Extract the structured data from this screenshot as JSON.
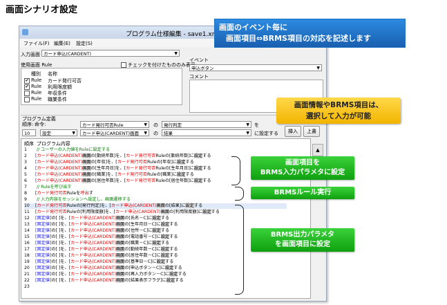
{
  "page_title": "画面シナリオ設定",
  "callout_top": {
    "line1": "画面のイベント毎に",
    "line2": "画面項目⇔BRMS項目の対応を記述します"
  },
  "window": {
    "title": "プログラム仕様編集 - save1.xml",
    "menu": [
      "ファイル(F)",
      "編集(E)",
      "設定(S)"
    ]
  },
  "screen_panel": {
    "label": "入力画面",
    "select_value": "カード申込(CARDENT)",
    "rule_used_label": "使用画面 Rule",
    "checked_only_label": "チェックを付けたもののみ表示",
    "header": {
      "kind": "種別",
      "name": "名称"
    },
    "rules": [
      {
        "checked": true,
        "kind": "Rule",
        "name": "カード発行可否"
      },
      {
        "checked": true,
        "kind": "Rule",
        "name": "利用限度額"
      },
      {
        "checked": false,
        "kind": "Rule",
        "name": "年収条件"
      },
      {
        "checked": false,
        "kind": "Rule",
        "name": "職業条件"
      }
    ]
  },
  "event_panel": {
    "label": "イベント",
    "select_value": "申込ボタン",
    "comment_label": "コメント"
  },
  "callout_select": {
    "line1": "画面情報やBRMS項目は、",
    "line2": "選択して入力が可能"
  },
  "program_def": {
    "section_label": "プログラム定義",
    "order_label": "順序:",
    "command_label": "命令:",
    "row1": {
      "field1": "カード発行可否Rule",
      "no": "の",
      "field2": "発行判定",
      "suffix": "を"
    },
    "row2": {
      "order": "10",
      "command": "設定",
      "field1": "カード申込(CARDENT)画面",
      "no": "の",
      "field2": "結果",
      "suffix": "に設定する"
    },
    "insert_button": "挿入",
    "overwrite_button": "上書"
  },
  "code": {
    "header_order": "順序",
    "header_content": "プログラム内容",
    "lines": [
      {
        "n": "1",
        "type": "comment",
        "text": "// ユーザーの入力値をRuleに設定する"
      },
      {
        "n": "2",
        "type": "in",
        "field": "勤続年数",
        "target": "勤続年数"
      },
      {
        "n": "3",
        "type": "in",
        "field": "年収",
        "target": "年収"
      },
      {
        "n": "4",
        "type": "in",
        "field": "生年月日",
        "target": "生年月日"
      },
      {
        "n": "5",
        "type": "in",
        "field": "職業",
        "target": "職業"
      },
      {
        "n": "6",
        "type": "in",
        "field": "居住年数",
        "target": "居住年数"
      },
      {
        "n": "7",
        "type": "comment",
        "text": "// Ruleを呼び出す"
      },
      {
        "n": "8",
        "type": "call"
      },
      {
        "n": "9",
        "type": "comment",
        "text": "// 入力内容をセッションへ設定し、画面遷移する"
      },
      {
        "n": "10",
        "type": "out",
        "rule_field": "発行判定",
        "screen_field": "結果"
      },
      {
        "n": "11",
        "type": "out",
        "rule_field": "利用限度額",
        "screen_field": "利用限度額"
      },
      {
        "n": "12",
        "type": "sess",
        "field": "氏名－C"
      },
      {
        "n": "13",
        "type": "sess",
        "field": "生年月日－C"
      },
      {
        "n": "14",
        "type": "sess",
        "field": "住所－C"
      },
      {
        "n": "15",
        "type": "sess",
        "field": "電話番号－C"
      },
      {
        "n": "16",
        "type": "sess",
        "field": "職業－C"
      },
      {
        "n": "17",
        "type": "sess",
        "field": "勤続年数－C"
      },
      {
        "n": "18",
        "type": "sess",
        "field": "居住年数－C"
      },
      {
        "n": "19",
        "type": "sess",
        "field": "基準日－C"
      },
      {
        "n": "20",
        "type": "sess",
        "field": "申込ボタン－C"
      },
      {
        "n": "21",
        "type": "sess",
        "field": "再入力ボタン－C"
      },
      {
        "n": "22",
        "type": "sess",
        "field": "結果表示フラグ"
      },
      {
        "n": "23",
        "type": "blank"
      }
    ]
  },
  "labels": {
    "green1_line1": "画面項目を",
    "green1_line2": "BRMS入力パラメタに設定",
    "green2": "BRMSルール実行",
    "green3_line1": "BRMS出力パラメタ",
    "green3_line2": "を画面項目に設定"
  },
  "colors": {
    "accent_blue": "#1a5fb0",
    "callout_green": "#17b017",
    "callout_yellow": "#f3b400",
    "code_red": "#e00000",
    "code_blue": "#1a1ae0"
  }
}
